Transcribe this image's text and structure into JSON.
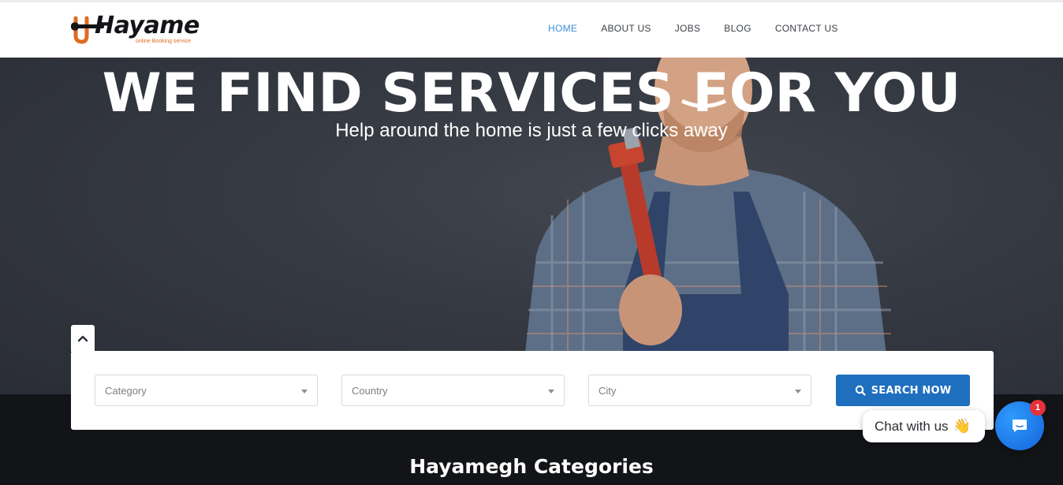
{
  "brand": {
    "name": "Hayame",
    "tagline": "online Booking service",
    "accent": "#e06b21"
  },
  "nav": {
    "items": [
      {
        "label": "HOME",
        "active": true
      },
      {
        "label": "ABOUT US",
        "active": false
      },
      {
        "label": "JOBS",
        "active": false
      },
      {
        "label": "BLOG",
        "active": false
      },
      {
        "label": "CONTACT US",
        "active": false
      }
    ],
    "active_color": "#3b8fd8"
  },
  "hero": {
    "title": "WE FIND SERVICES FOR YOU",
    "subtitle": "Help around the home is just a few clicks away"
  },
  "search": {
    "category": {
      "placeholder": "Category"
    },
    "country": {
      "placeholder": "Country"
    },
    "city": {
      "placeholder": "City"
    },
    "button_label": "SEARCH NOW",
    "button_icon": "search-icon",
    "button_color": "#1f6fbf"
  },
  "collapse_icon": "chevron-up-icon",
  "categories": {
    "title": "Hayamegh Categories"
  },
  "chat": {
    "bubble_text": "Chat with us",
    "bubble_emoji": "👋",
    "badge_count": "1",
    "launcher_icon": "chat-icon",
    "launcher_color": "#1463d8"
  }
}
